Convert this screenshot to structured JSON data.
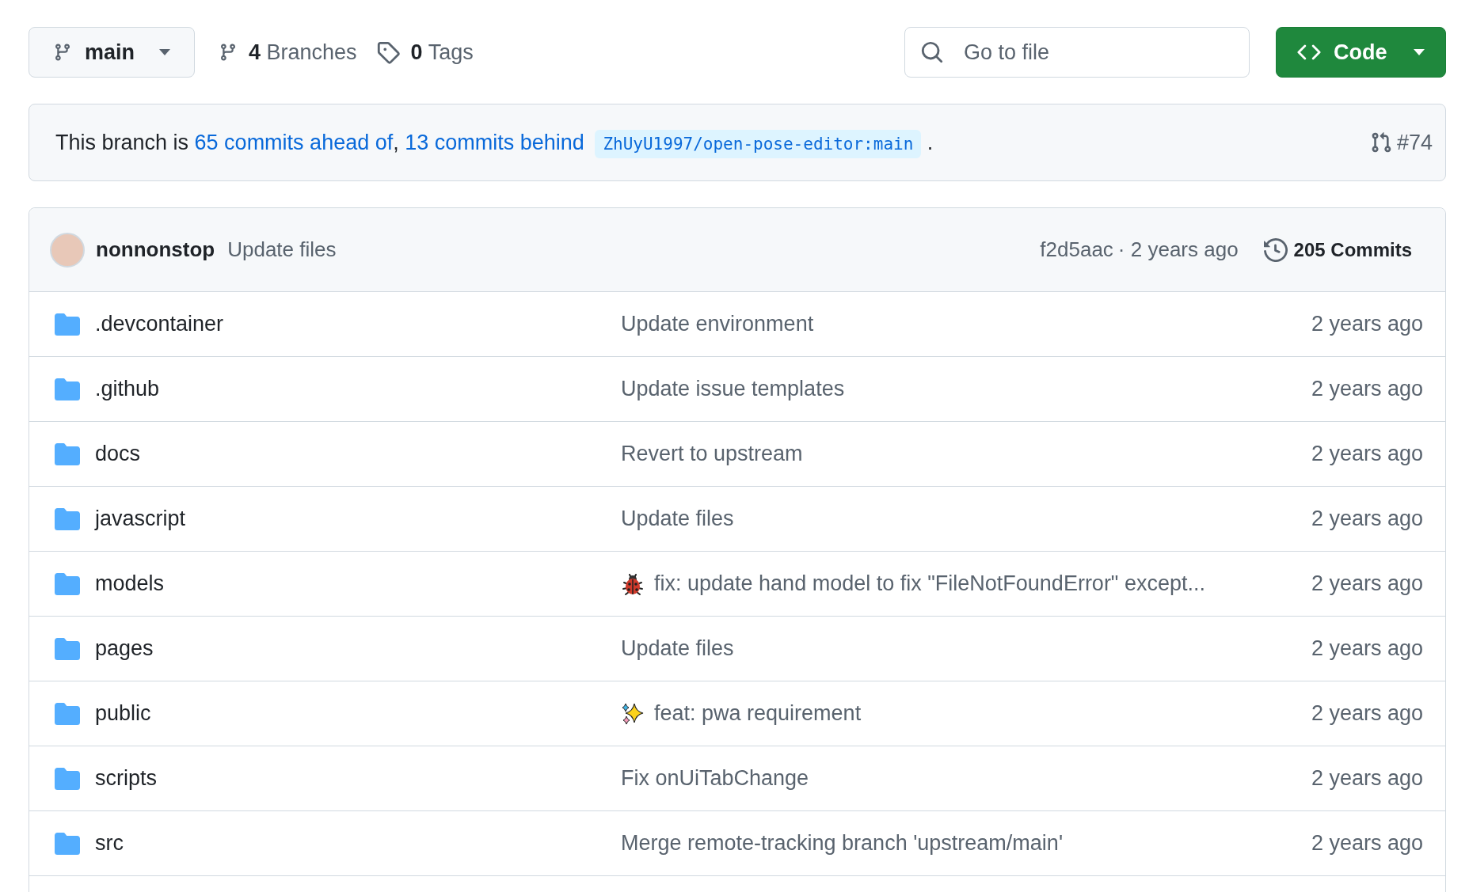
{
  "branch_selector": {
    "label": "main"
  },
  "branches": {
    "count": "4",
    "label": "Branches"
  },
  "tags": {
    "count": "0",
    "label": "Tags"
  },
  "search": {
    "placeholder": "Go to file"
  },
  "code_button": {
    "label": "Code"
  },
  "banner": {
    "prefix": "This branch is ",
    "ahead_link": "65 commits ahead of",
    "separator": ", ",
    "behind_link": "13 commits behind",
    "upstream": "ZhUyU1997/open-pose-editor:main",
    "suffix": ".",
    "pull_request": "#74"
  },
  "latest_commit": {
    "author": "nonnonstop",
    "message": "Update files",
    "hash": "f2d5aac",
    "time": "· 2 years ago",
    "commits": "205 Commits"
  },
  "files": [
    {
      "name": ".devcontainer",
      "kind": "plain",
      "message": "Update environment",
      "age": "2 years ago"
    },
    {
      "name": ".github",
      "kind": "plain",
      "message": "Update issue templates",
      "age": "2 years ago"
    },
    {
      "name": "docs",
      "kind": "plain",
      "message": "Revert to upstream",
      "age": "2 years ago"
    },
    {
      "name": "javascript",
      "kind": "plain",
      "message": "Update files",
      "age": "2 years ago"
    },
    {
      "name": "models",
      "kind": "bug",
      "message": "fix: update hand model to fix \"FileNotFoundError\" except...",
      "age": "2 years ago"
    },
    {
      "name": "pages",
      "kind": "plain",
      "message": "Update files",
      "age": "2 years ago"
    },
    {
      "name": "public",
      "kind": "sparkles",
      "message": "feat: pwa requirement",
      "age": "2 years ago"
    },
    {
      "name": "scripts",
      "kind": "plain",
      "message": "Fix onUiTabChange",
      "age": "2 years ago"
    },
    {
      "name": "src",
      "kind": "plain",
      "message": "Merge remote-tracking branch 'upstream/main'",
      "age": "2 years ago"
    }
  ]
}
